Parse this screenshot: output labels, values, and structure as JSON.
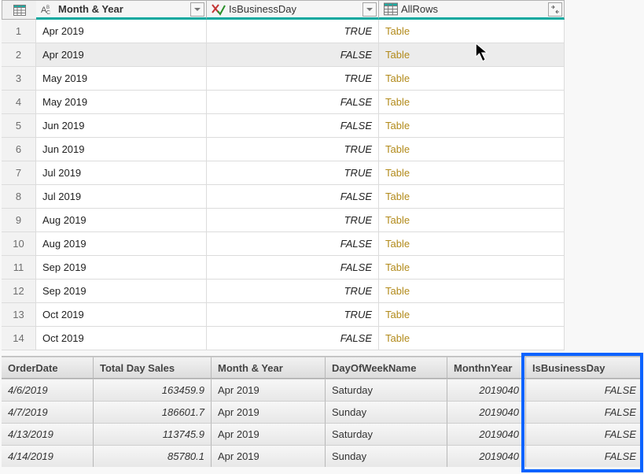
{
  "topGrid": {
    "columns": [
      {
        "label": "Month & Year"
      },
      {
        "label": "IsBusinessDay"
      },
      {
        "label": "AllRows"
      }
    ],
    "rows": [
      {
        "n": "1",
        "month": "Apr 2019",
        "biz": "TRUE",
        "link": "Table"
      },
      {
        "n": "2",
        "month": "Apr 2019",
        "biz": "FALSE",
        "link": "Table"
      },
      {
        "n": "3",
        "month": "May 2019",
        "biz": "TRUE",
        "link": "Table"
      },
      {
        "n": "4",
        "month": "May 2019",
        "biz": "FALSE",
        "link": "Table"
      },
      {
        "n": "5",
        "month": "Jun 2019",
        "biz": "FALSE",
        "link": "Table"
      },
      {
        "n": "6",
        "month": "Jun 2019",
        "biz": "TRUE",
        "link": "Table"
      },
      {
        "n": "7",
        "month": "Jul 2019",
        "biz": "TRUE",
        "link": "Table"
      },
      {
        "n": "8",
        "month": "Jul 2019",
        "biz": "FALSE",
        "link": "Table"
      },
      {
        "n": "9",
        "month": "Aug 2019",
        "biz": "TRUE",
        "link": "Table"
      },
      {
        "n": "10",
        "month": "Aug 2019",
        "biz": "FALSE",
        "link": "Table"
      },
      {
        "n": "11",
        "month": "Sep 2019",
        "biz": "FALSE",
        "link": "Table"
      },
      {
        "n": "12",
        "month": "Sep 2019",
        "biz": "TRUE",
        "link": "Table"
      },
      {
        "n": "13",
        "month": "Oct 2019",
        "biz": "TRUE",
        "link": "Table"
      },
      {
        "n": "14",
        "month": "Oct 2019",
        "biz": "FALSE",
        "link": "Table"
      }
    ]
  },
  "preview": {
    "headers": {
      "orderDate": "OrderDate",
      "totalDaySales": "Total Day Sales",
      "monthYear": "Month & Year",
      "dayOfWeek": "DayOfWeekName",
      "monthnYear": "MonthnYear",
      "isBusinessDay": "IsBusinessDay"
    },
    "rows": [
      {
        "date": "4/6/2019",
        "sales": "163459.9",
        "my": "Apr 2019",
        "dow": "Saturday",
        "myn": "2019040",
        "biz": "FALSE"
      },
      {
        "date": "4/7/2019",
        "sales": "186601.7",
        "my": "Apr 2019",
        "dow": "Sunday",
        "myn": "2019040",
        "biz": "FALSE"
      },
      {
        "date": "4/13/2019",
        "sales": "113745.9",
        "my": "Apr 2019",
        "dow": "Saturday",
        "myn": "2019040",
        "biz": "FALSE"
      },
      {
        "date": "4/14/2019",
        "sales": "85780.1",
        "my": "Apr 2019",
        "dow": "Sunday",
        "myn": "2019040",
        "biz": "FALSE"
      }
    ]
  }
}
